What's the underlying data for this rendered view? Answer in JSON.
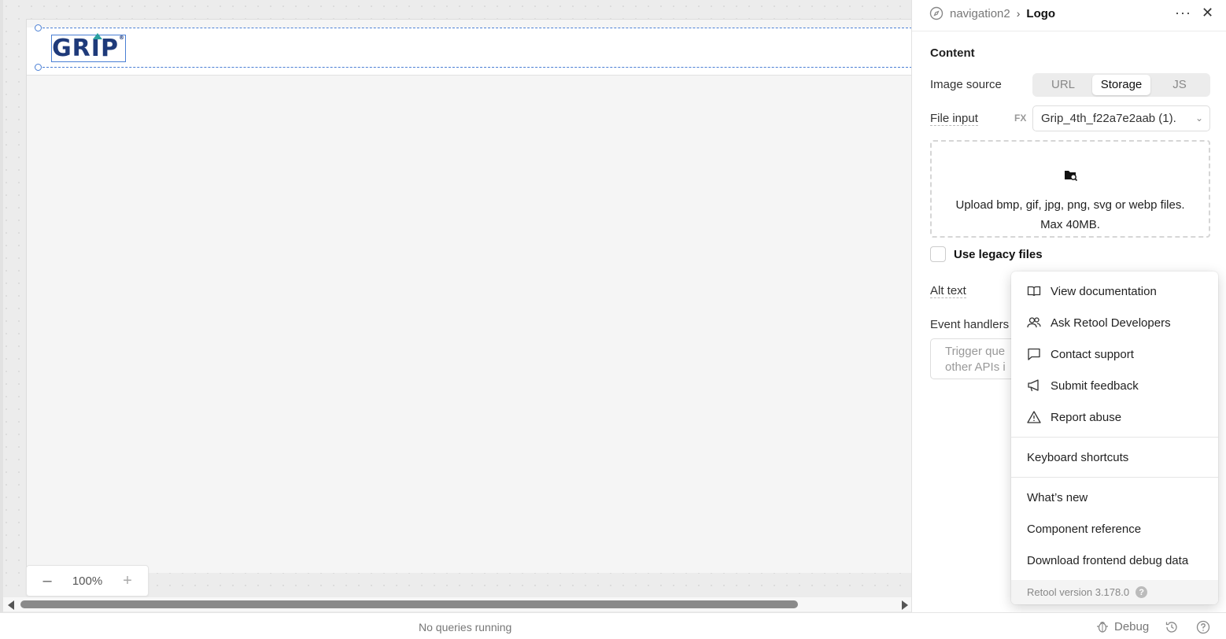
{
  "canvas": {
    "zoom": {
      "minus_label": "–",
      "value": "100%",
      "plus_label": "+"
    },
    "logo": {
      "text": "GRIP",
      "reg": "®"
    }
  },
  "status_bar": {
    "queries_text": "No queries running",
    "debug_label": "Debug"
  },
  "panel": {
    "breadcrumb": {
      "parent": "navigation2",
      "separator": "›",
      "current": "Logo"
    },
    "more_label": "···",
    "close_label": "✕",
    "section_title": "Content",
    "image_source": {
      "label": "Image source",
      "options": [
        "URL",
        "Storage",
        "JS"
      ],
      "selected": "Storage"
    },
    "file_input": {
      "label": "File input",
      "fx": "FX",
      "value": "Grip_4th_f22a7e2aab (1)."
    },
    "dropzone": {
      "line1": "Upload bmp, gif, jpg, png, svg or webp files.",
      "line2": "Max 40MB."
    },
    "legacy": {
      "label": "Use legacy files"
    },
    "alt_text": {
      "label": "Alt text"
    },
    "event_handlers": {
      "label": "Event handlers",
      "placeholder_line1": "Trigger que",
      "placeholder_line2": "other APIs i"
    }
  },
  "menu": {
    "items": [
      {
        "label": "View documentation",
        "icon": "book-icon"
      },
      {
        "label": "Ask Retool Developers",
        "icon": "users-icon"
      },
      {
        "label": "Contact support",
        "icon": "message-icon"
      },
      {
        "label": "Submit feedback",
        "icon": "megaphone-icon"
      },
      {
        "label": "Report abuse",
        "icon": "warning-icon"
      }
    ],
    "keyboard_shortcuts": "Keyboard shortcuts",
    "links": [
      {
        "label": "What’s new"
      },
      {
        "label": "Component reference"
      },
      {
        "label": "Download frontend debug data"
      }
    ],
    "version": "Retool version 3.178.0"
  },
  "colors": {
    "selection": "#4a7fd4",
    "logo_navy": "#1e3a7a",
    "logo_teal": "#2aa0a0"
  }
}
